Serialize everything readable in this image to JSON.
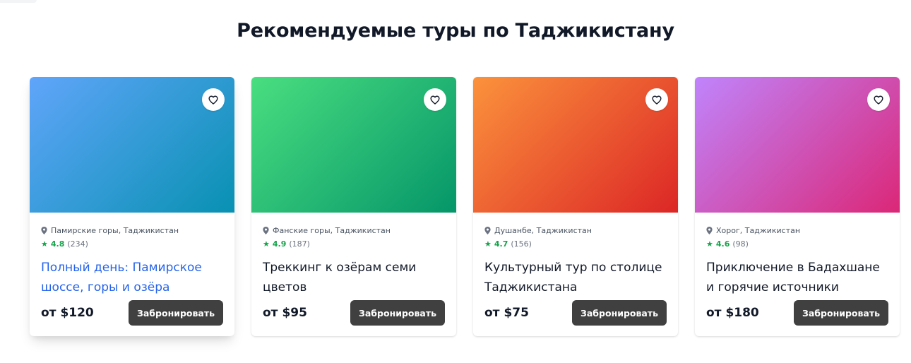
{
  "section": {
    "title": "Рекомендуемые туры по Таджикистану"
  },
  "colors": {
    "rating": "#16a34a",
    "button": "#404040",
    "link_title": "#2563eb"
  },
  "tours": [
    {
      "image_gradient": [
        "#60a5fa",
        "#0891b2"
      ],
      "location": "Памирские горы, Таджикистан",
      "rating": "4.8",
      "reviews": "(234)",
      "title": "Полный день: Памирское шоссе, горы и озёра",
      "price": "от $120",
      "button": "Забронировать",
      "favorite_icon": "heart-icon"
    },
    {
      "image_gradient": [
        "#4ade80",
        "#059669"
      ],
      "location": "Фанские горы, Таджикистан",
      "rating": "4.9",
      "reviews": "(187)",
      "title": "Треккинг к озёрам семи цветов",
      "price": "от $95",
      "button": "Забронировать",
      "favorite_icon": "heart-icon"
    },
    {
      "image_gradient": [
        "#fb923c",
        "#dc2626"
      ],
      "location": "Душанбе, Таджикистан",
      "rating": "4.7",
      "reviews": "(156)",
      "title": "Культурный тур по столице Таджикистана",
      "price": "от $75",
      "button": "Забронировать",
      "favorite_icon": "heart-icon"
    },
    {
      "image_gradient": [
        "#c084fc",
        "#db2777"
      ],
      "location": "Хорог, Таджикистан",
      "rating": "4.6",
      "reviews": "(98)",
      "title": "Приключение в Бадахшане и горячие источники",
      "price": "от $180",
      "button": "Забронировать",
      "favorite_icon": "heart-icon"
    }
  ]
}
